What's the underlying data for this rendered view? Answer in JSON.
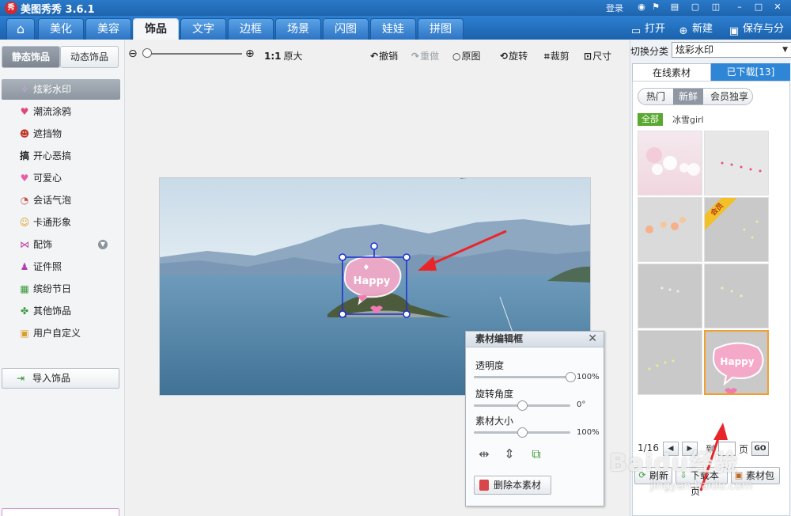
{
  "app": {
    "title": "美图秀秀 3.6.1",
    "logo": "秀",
    "login": "登录"
  },
  "nav": {
    "tabs": [
      "美化",
      "美容",
      "饰品",
      "文字",
      "边框",
      "场景",
      "闪图",
      "娃娃",
      "拼图"
    ],
    "active": "饰品",
    "actions": {
      "open": "打开",
      "new": "新建",
      "save": "保存与分享"
    }
  },
  "sidebar": {
    "tabs": {
      "static": "静态饰品",
      "dynamic": "动态饰品"
    },
    "items": [
      "炫彩水印",
      "潮流涂鸦",
      "遮挡物",
      "开心恶搞",
      "可爱心",
      "会话气泡",
      "卡通形象",
      "配饰",
      "证件照",
      "缤纷节日",
      "其他饰品",
      "用户自定义"
    ],
    "selected": "炫彩水印",
    "import": "导入饰品"
  },
  "toolbar": {
    "actual_ratio": "1:1",
    "actual_label": "原大",
    "undo": "撤销",
    "redo": "重做",
    "original": "原图",
    "rotate": "旋转",
    "crop": "裁剪",
    "size": "尺寸"
  },
  "sticker": {
    "text": "Happy"
  },
  "editor": {
    "title": "素材编辑框",
    "close": "✕",
    "opacity_label": "透明度",
    "opacity_value": "100%",
    "opacity_fraction": 1.0,
    "rotation_label": "旋转角度",
    "rotation_value": "0°",
    "rotation_fraction": 0.5,
    "size_label": "素材大小",
    "size_value": "100%",
    "size_fraction": 0.5,
    "delete": "删除本素材"
  },
  "right": {
    "switch_label": "切换分类",
    "switch_value": "炫彩水印",
    "tabs": {
      "online": "在线素材",
      "downloaded": "已下载[13]"
    },
    "filters": [
      "热门",
      "新鲜",
      "会员独享"
    ],
    "active_filter": "新鲜",
    "all": "全部",
    "author": "冰雪girl",
    "vip": "会员",
    "page": "1/16",
    "to": "到",
    "page_unit": "页",
    "go": "GO",
    "refresh": "刷新",
    "download_page": "下载本页",
    "pack": "素材包"
  },
  "watermark": {
    "brand": "Baidu经验",
    "url": "jingyan.baidu.com"
  },
  "colors": {
    "nav_blue": "#2d7fd2",
    "selected_border": "#f0a030",
    "arrow_red": "#e8262a"
  }
}
